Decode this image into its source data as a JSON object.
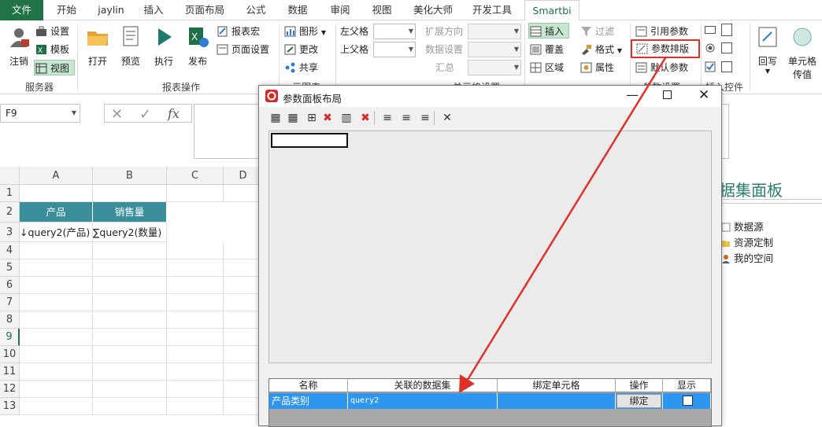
{
  "ribbon_tabs": [
    "文件",
    "开始",
    "jaylin",
    "插入",
    "页面布局",
    "公式",
    "数据",
    "审阅",
    "视图",
    "美化大师",
    "开发工具",
    "Smartbi"
  ],
  "ribbon": {
    "server": {
      "logout": "注销",
      "settings": "设置",
      "template": "模板",
      "view": "视图",
      "group": "服务器"
    },
    "report_ops": {
      "open": "打开",
      "preview": "预览",
      "execute": "执行",
      "publish": "发布",
      "macro": "报表宏",
      "page_setup": "页面设置",
      "group": "报表操作"
    },
    "app": {
      "chart": "图形",
      "change": "更改",
      "share": "共享",
      "group": "元图表"
    },
    "cell_settings": {
      "left_parent": "左父格",
      "top_parent": "上父格",
      "expand_dir": "扩展方向",
      "data_settings": "数据设置",
      "summary": "汇总",
      "group": "单元格设置"
    },
    "insert": {
      "insert": "插入",
      "cover": "覆盖",
      "area": "区域"
    },
    "filter": {
      "filter": "过滤",
      "format": "格式",
      "property": "属性"
    },
    "params": {
      "ref_param": "引用参数",
      "param_layout": "参数排版",
      "default_param": "默认参数",
      "group": "参数设置"
    },
    "controls": {
      "group": "插入控件"
    },
    "misc": {
      "writeback": "回写",
      "cell_pass": "单元格",
      "cell_pass2": "传值"
    }
  },
  "formula_bar": {
    "name_box": "F9",
    "fx": "fx"
  },
  "sheet": {
    "columns": [
      "A",
      "B",
      "C",
      "D"
    ],
    "rows": [
      "1",
      "2",
      "3",
      "4",
      "5",
      "6",
      "7",
      "8",
      "9",
      "10",
      "11",
      "12",
      "13"
    ],
    "headers": [
      "产品",
      "销售量"
    ],
    "row3": [
      "↓query2(产品)",
      "∑query2(数量)"
    ]
  },
  "dialog": {
    "title": "参数面板布局",
    "grid_columns": [
      "名称",
      "关联的数据集",
      "绑定单元格",
      "操作",
      "显示"
    ],
    "rows": [
      {
        "name": "产品类别",
        "dataset": "query2",
        "cell": "",
        "action": "绑定",
        "show": false
      }
    ]
  },
  "right_panel": {
    "title": "据集面板",
    "items": [
      "数据源",
      "资源定制",
      "我的空间"
    ]
  },
  "colors": {
    "excel_green": "#217346",
    "header_teal": "#3b8f9b",
    "selection_blue": "#2f96f0",
    "annotation_red": "#e0302a"
  }
}
